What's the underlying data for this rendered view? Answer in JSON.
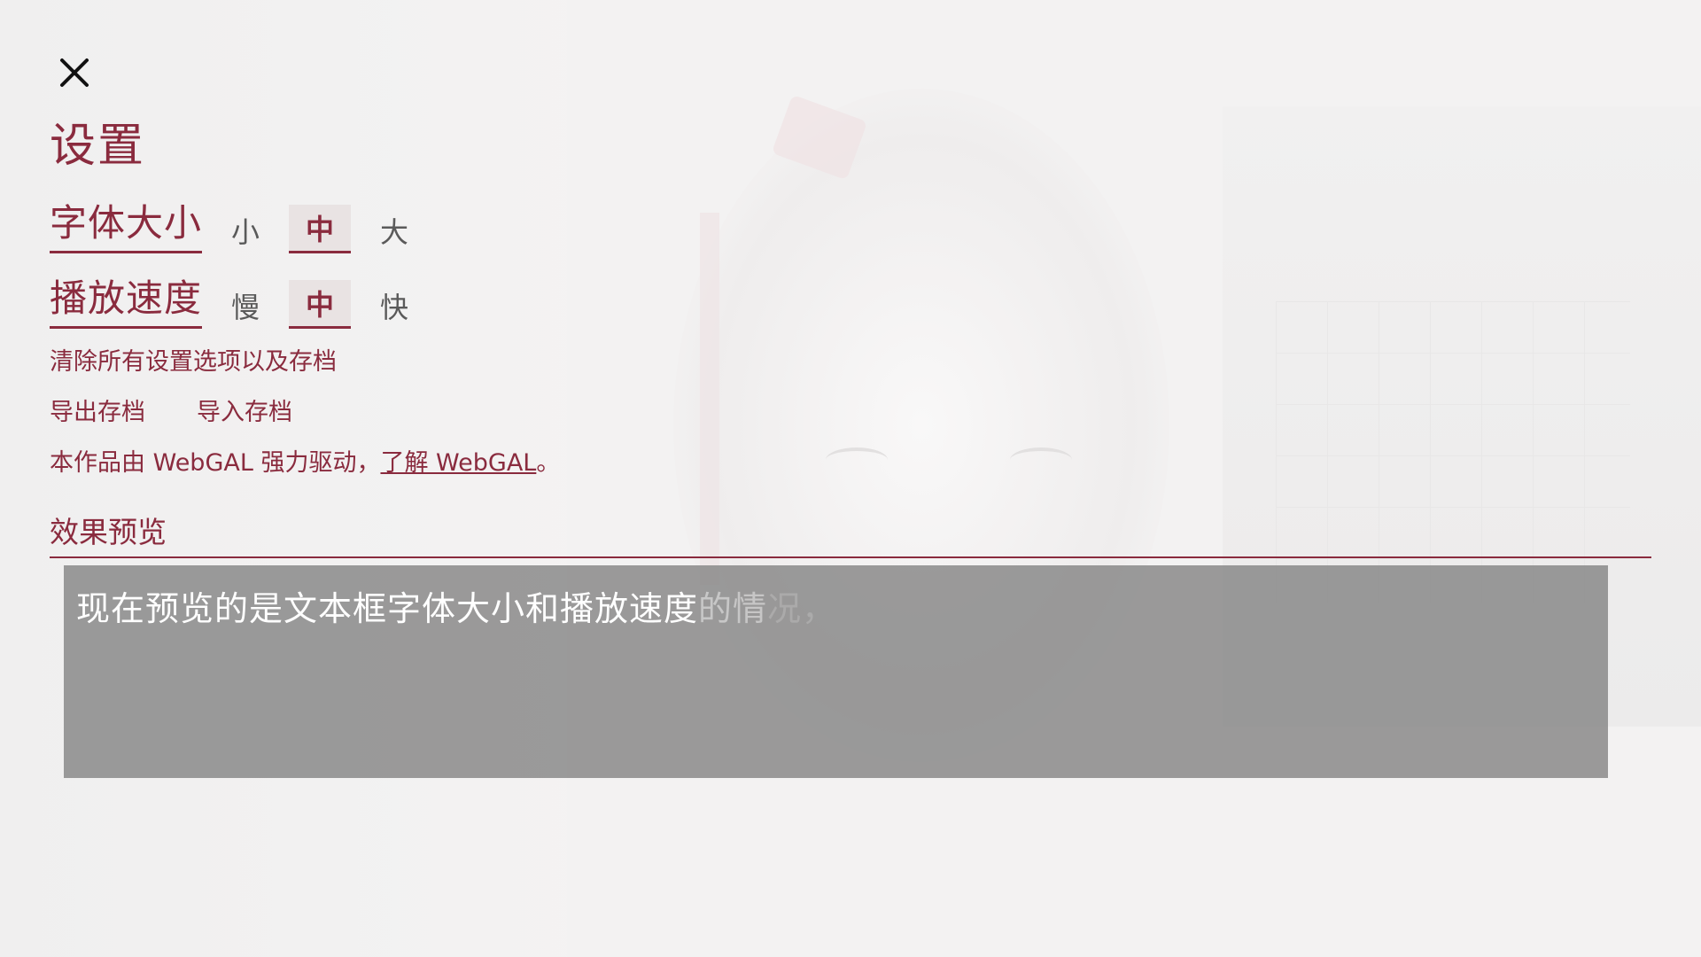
{
  "close_icon": "close-icon",
  "title": "设置",
  "font_size": {
    "label": "字体大小",
    "options": [
      "小",
      "中",
      "大"
    ],
    "selected": "中"
  },
  "play_speed": {
    "label": "播放速度",
    "options": [
      "慢",
      "中",
      "快"
    ],
    "selected": "中"
  },
  "reset_label": "清除所有设置选项以及存档",
  "export_label": "导出存档",
  "import_label": "导入存档",
  "credit": {
    "prefix": "本作品由 WebGAL 强力驱动，",
    "link": "了解 WebGAL",
    "suffix": "。"
  },
  "preview": {
    "heading": "效果预览",
    "text_solid": "现在预览的是文本框字体大小和播放速度",
    "text_fade": "的情",
    "text_fade2": "况，"
  },
  "colors": {
    "accent": "#8a2b3e",
    "preview_bg": "#808080"
  }
}
